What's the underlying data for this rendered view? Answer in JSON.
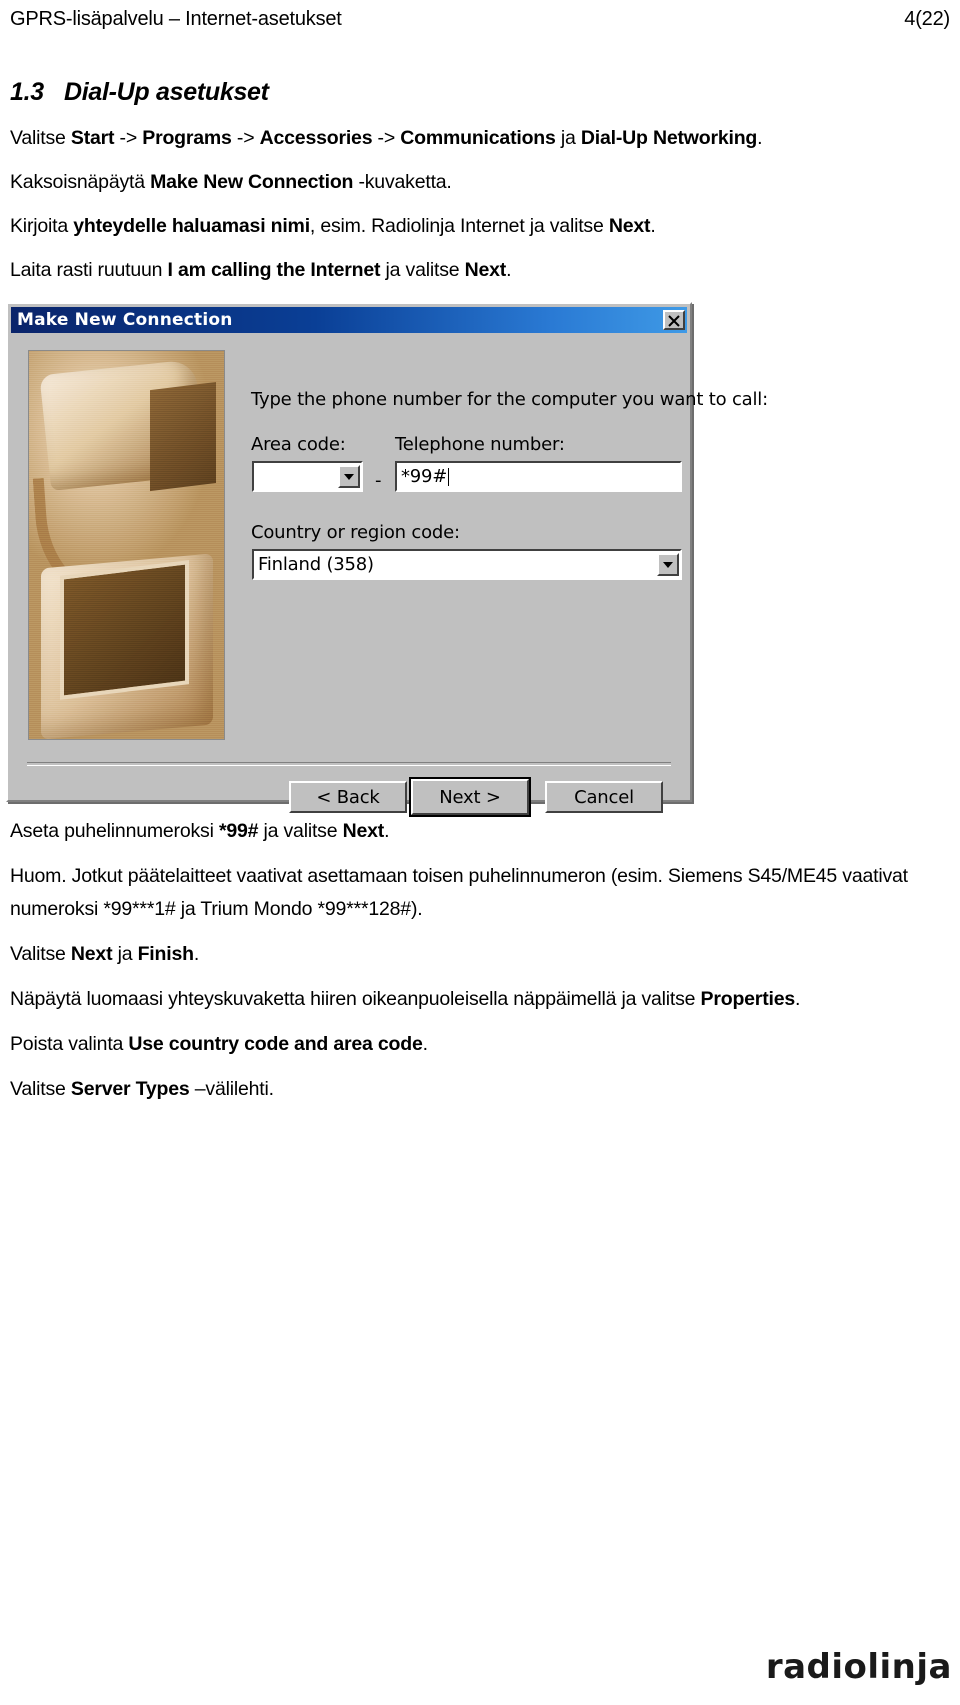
{
  "header": {
    "left": "GPRS-lisäpalvelu – Internet-asetukset",
    "right": "4(22)"
  },
  "section": {
    "number": "1.3",
    "title": "Dial-Up asetukset"
  },
  "intro": {
    "line1": {
      "t1": "Valitse ",
      "b1": "Start",
      "t2": " -> ",
      "b2": "Programs",
      "t3": " -> ",
      "b3": "Accessories",
      "t4": " -> ",
      "b4": "Communications",
      "t5": " ja ",
      "b5": "Dial-Up Networking",
      "t6": "."
    },
    "line2": {
      "t1": "Kaksoisnäpäytä ",
      "b1": "Make New Connection",
      "t2": " -kuvaketta."
    },
    "line3": {
      "t1": "Kirjoita ",
      "b1": "yhteydelle haluamasi nimi",
      "t2": ", esim. Radiolinja Internet ja valitse ",
      "b2": "Next",
      "t3": "."
    },
    "line4": {
      "t1": "Laita rasti ruutuun ",
      "b1": "I am calling the Internet",
      "t2": " ja valitse ",
      "b2": "Next",
      "t3": "."
    }
  },
  "dialog": {
    "title": "Make New Connection",
    "close_icon": "close-icon",
    "prompt": "Type the phone number for the computer you want to call:",
    "labels": {
      "area_code": "Area code:",
      "telephone_number": "Telephone number:",
      "country_code": "Country or region code:"
    },
    "fields": {
      "area_code_value": "",
      "telephone_number_value": "*99#",
      "country_code_value": "Finland (358)"
    },
    "separator": "-",
    "buttons": {
      "back": "< Back",
      "next": "Next >",
      "cancel": "Cancel"
    }
  },
  "after": {
    "line1": {
      "t1": "Aseta puhelinnumeroksi ",
      "b1": "*99#",
      "t2": " ja valitse ",
      "b2": "Next",
      "t3": "."
    },
    "line2": {
      "t1": "Huom. Jotkut päätelaitteet vaativat asettamaan toisen puhelinnumeron (esim. Siemens S45/ME45 vaativat numeroksi *99***1# ja Trium Mondo *99***128#)."
    },
    "line3": {
      "t1": "Valitse ",
      "b1": "Next",
      "t2": " ja ",
      "b2": "Finish",
      "t3": "."
    },
    "line4": {
      "t1": "Näpäytä luomaasi yhteyskuvaketta hiiren oikeanpuoleisella näppäimellä ja valitse ",
      "b1": "Properties",
      "t2": "."
    },
    "line5": {
      "t1": "Poista valinta ",
      "b1": "Use country code and area code",
      "t2": "."
    },
    "line6": {
      "t1": "Valitse ",
      "b1": "Server Types",
      "t2": " –välilehti."
    }
  },
  "footer": {
    "logo": "radiolinja"
  }
}
